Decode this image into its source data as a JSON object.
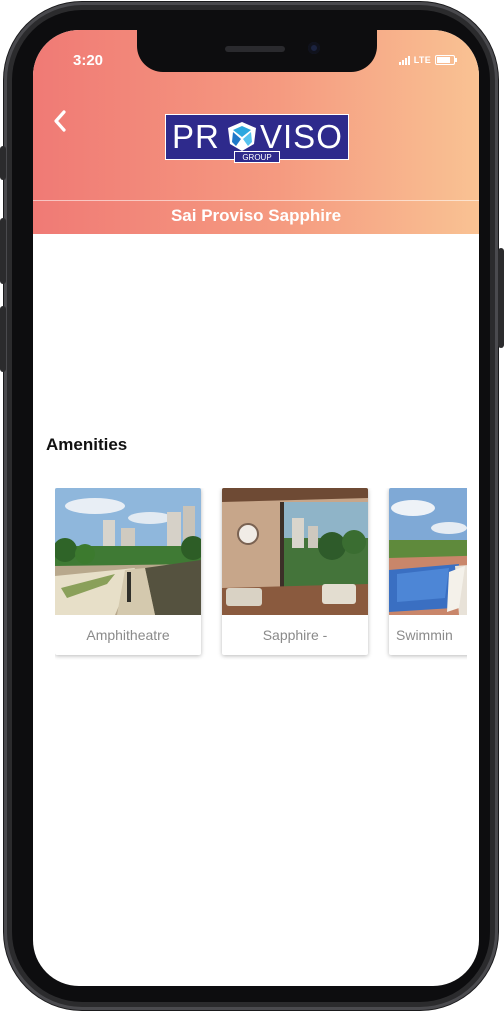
{
  "status_bar": {
    "time": "3:20",
    "network": "LTE"
  },
  "header": {
    "logo": {
      "word_left": "PR",
      "word_right": "VISO",
      "sub": "GROUP"
    },
    "project_title": "Sai Proviso Sapphire"
  },
  "icons": {
    "back": "chevron-left-icon",
    "logo_mark": "proviso-logo-mark-icon"
  },
  "colors": {
    "header_gradient_start": "#f07a75",
    "header_gradient_end": "#f9c293",
    "logo_bg": "#2e2a8c"
  },
  "amenities": {
    "title": "Amenities",
    "items": [
      {
        "label": "Amphitheatre"
      },
      {
        "label": "Sapphire -"
      },
      {
        "label": "Swimmin"
      }
    ]
  }
}
